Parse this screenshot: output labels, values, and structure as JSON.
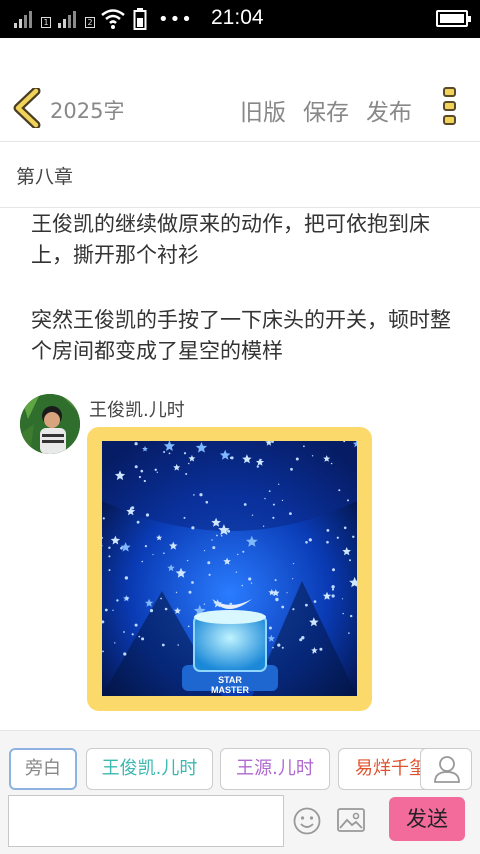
{
  "status_bar": {
    "sim1_label": "1",
    "sim2_label": "2",
    "time": "21:04",
    "overflow_dots": "•••"
  },
  "toolbar": {
    "back_icon": "chevron-left-icon",
    "word_count": "2025字",
    "old_version_label": "旧版",
    "save_label": "保存",
    "publish_label": "发布",
    "menu_icon": "more-vertical-icon"
  },
  "chapter": {
    "title": "第八章"
  },
  "content": {
    "paragraph_1": "王俊凯的继续做原来的动作，把可依抱到床上，撕开那个衬衫",
    "paragraph_2": "突然王俊凯的手按了一下床头的开关，顿时整个房间都变成了星空的模样",
    "message": {
      "speaker_name": "王俊凯.儿时",
      "image_caption_line1": "STAR",
      "image_caption_line2": "MASTER"
    }
  },
  "roles": [
    {
      "label": "旁白",
      "color": "#888888"
    },
    {
      "label": "王俊凯.儿时",
      "color": "#3cb8b0"
    },
    {
      "label": "王源.儿时",
      "color": "#b06ad0"
    },
    {
      "label": "易烊千玺",
      "color": "#e0522e"
    }
  ],
  "composer": {
    "input_value": "",
    "input_placeholder": "",
    "send_label": "发送",
    "emoji_icon": "smiley-icon",
    "image_icon": "image-picker-icon",
    "role_icon": "person-icon"
  },
  "colors": {
    "accent_yellow": "#f1d35a",
    "send_pink": "#f26b9b",
    "frame_yellow": "#fbd96a"
  }
}
